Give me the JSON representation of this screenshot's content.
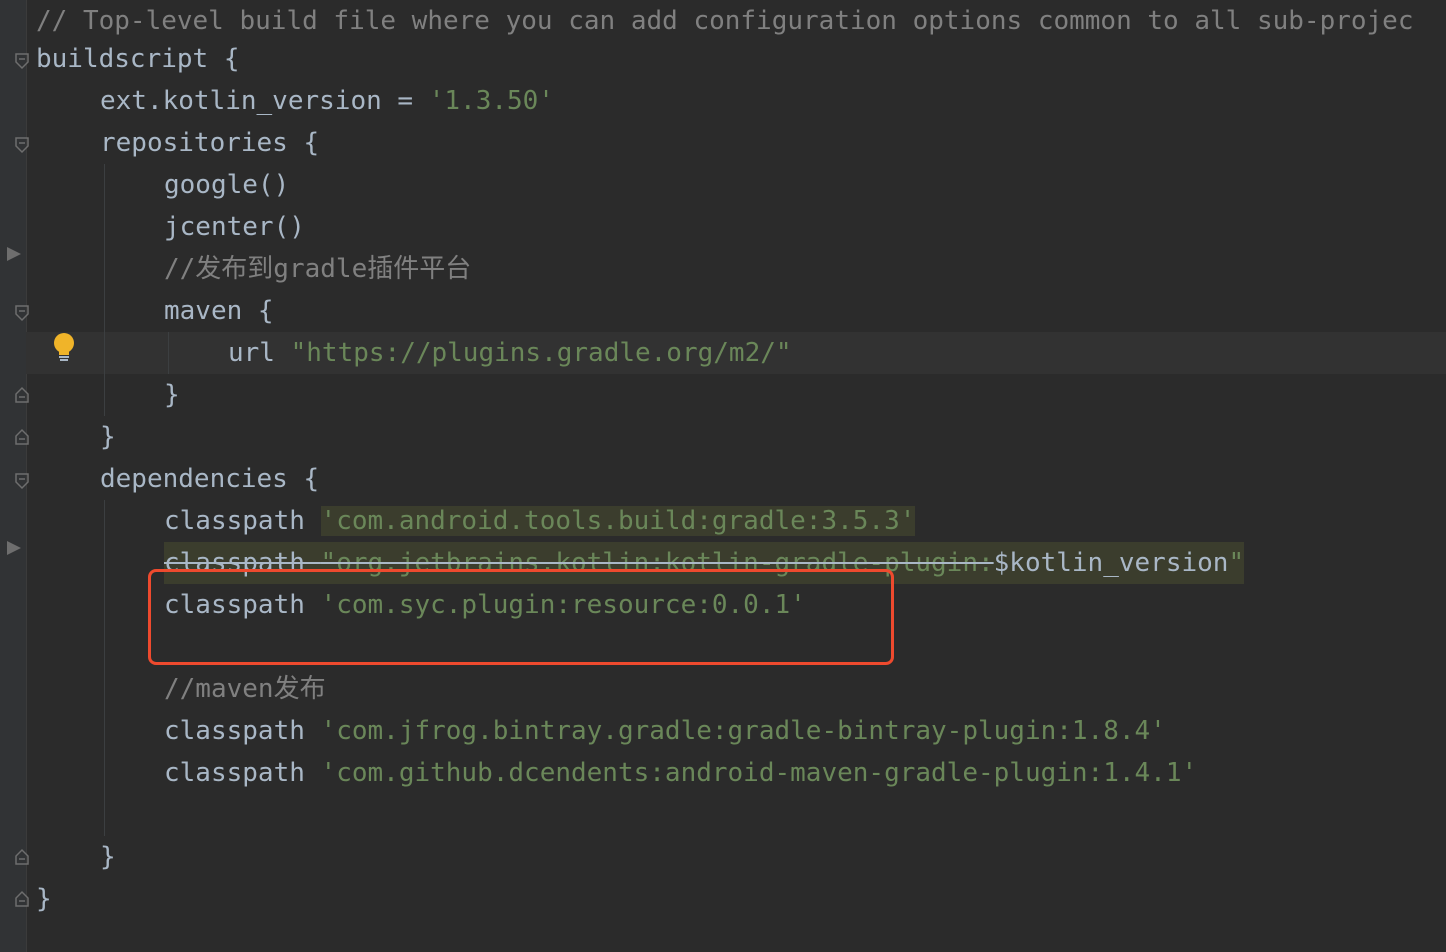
{
  "editor": {
    "lines": {
      "l1": "// Top-level build file where you can add configuration options common to all sub-projec",
      "l2": "buildscript {",
      "l3_a": "ext.kotlin_version = ",
      "l3_b": "'1.3.50'",
      "l4": "repositories {",
      "l5": "google()",
      "l6": "jcenter()",
      "l7": "//发布到gradle插件平台",
      "l8": "maven {",
      "l9_a": "url ",
      "l9_b": "\"https://plugins.gradle.org/m2/\"",
      "l10": "}",
      "l11": "}",
      "l12": "dependencies {",
      "l13_a": "classpath ",
      "l13_b": "'com.android.tools.build:gradle:3.5.3'",
      "l14_a": "classpath ",
      "l14_b": "\"org.jetbrains.kotlin:kotlin-gradle-plugin:",
      "l14_c": "$kotlin_version",
      "l14_d": "\"",
      "l15_a": "classpath ",
      "l15_b": "'com.syc.plugin:resource:0.0.1'",
      "l17": "//maven发布",
      "l18_a": "classpath ",
      "l18_b": "'com.jfrog.bintray.gradle:gradle-bintray-plugin:1.8.4'",
      "l19_a": "classpath ",
      "l19_b": "'com.github.dcendents:android-maven-gradle-plugin:1.4.1'",
      "l21": "}",
      "l22": "}"
    }
  },
  "icons": {
    "intention": "lightbulb-icon",
    "fold_open": "fold-open-icon",
    "fold_close": "fold-close-icon",
    "run": "run-arrow-icon"
  },
  "colors": {
    "background": "#2b2b2b",
    "gutter": "#313335",
    "comment": "#808080",
    "string": "#6a8759",
    "text": "#a9b7c6",
    "highlight": "#3b3d2d",
    "annotation_box": "#ee4a2e",
    "bulb": "#f0b429"
  }
}
